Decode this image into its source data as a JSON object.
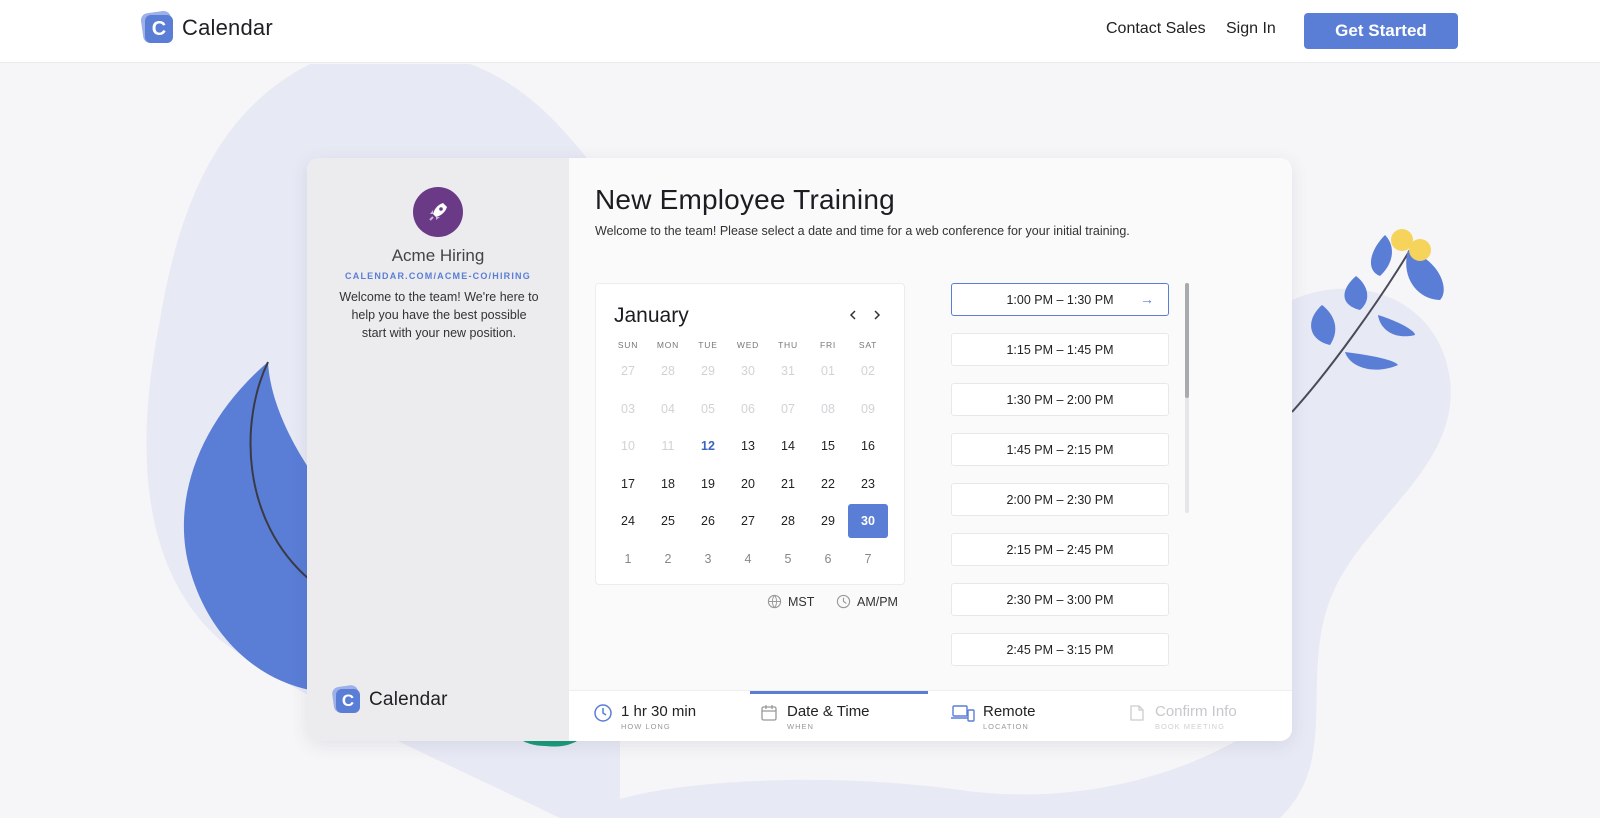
{
  "header": {
    "brand": "Calendar",
    "logo_letter": "C",
    "nav": {
      "contact_sales": "Contact Sales",
      "sign_in": "Sign In",
      "get_started": "Get Started"
    }
  },
  "profile": {
    "avatar_icon": "rocket-icon",
    "name": "Acme Hiring",
    "url": "CALENDAR.COM/ACME-CO/HIRING",
    "description": "Welcome to the team! We're here to help you have the best possible start with your new position.",
    "footer_brand": "Calendar"
  },
  "event": {
    "title": "New Employee Training",
    "subtitle": "Welcome to the team! Please select a date and time for a web conference for your initial training."
  },
  "calendar": {
    "month": "January",
    "weekdays": [
      "SUN",
      "MON",
      "TUE",
      "WED",
      "THU",
      "FRI",
      "SAT"
    ],
    "weeks": [
      [
        "27",
        "28",
        "29",
        "30",
        "31",
        "01",
        "02"
      ],
      [
        "03",
        "04",
        "05",
        "06",
        "07",
        "08",
        "09"
      ],
      [
        "10",
        "11",
        "12",
        "13",
        "14",
        "15",
        "16"
      ],
      [
        "17",
        "18",
        "19",
        "20",
        "21",
        "22",
        "23"
      ],
      [
        "24",
        "25",
        "26",
        "27",
        "28",
        "29",
        "30"
      ],
      [
        "1",
        "2",
        "3",
        "4",
        "5",
        "6",
        "7"
      ]
    ],
    "today": "12",
    "selected": "30",
    "timezone": "MST",
    "time_format": "AM/PM"
  },
  "slots": [
    "1:00 PM – 1:30 PM",
    "1:15 PM – 1:45 PM",
    "1:30 PM – 2:00 PM",
    "1:45 PM – 2:15 PM",
    "2:00 PM – 2:30 PM",
    "2:15 PM – 2:45 PM",
    "2:30 PM – 3:00 PM",
    "2:45 PM – 3:15 PM",
    ""
  ],
  "steps": [
    {
      "label": "1 hr 30 min",
      "sub": "HOW LONG",
      "icon": "clock-icon"
    },
    {
      "label": "Date & Time",
      "sub": "WHEN",
      "icon": "calendar-icon"
    },
    {
      "label": "Remote",
      "sub": "LOCATION",
      "icon": "devices-icon"
    },
    {
      "label": "Confirm Info",
      "sub": "BOOK MEETING",
      "icon": "document-icon"
    }
  ],
  "colors": {
    "accent": "#5a7dd6",
    "avatar": "#6b3a86",
    "leaf_green": "#1a9b79",
    "flower_yellow": "#f6d35a"
  }
}
